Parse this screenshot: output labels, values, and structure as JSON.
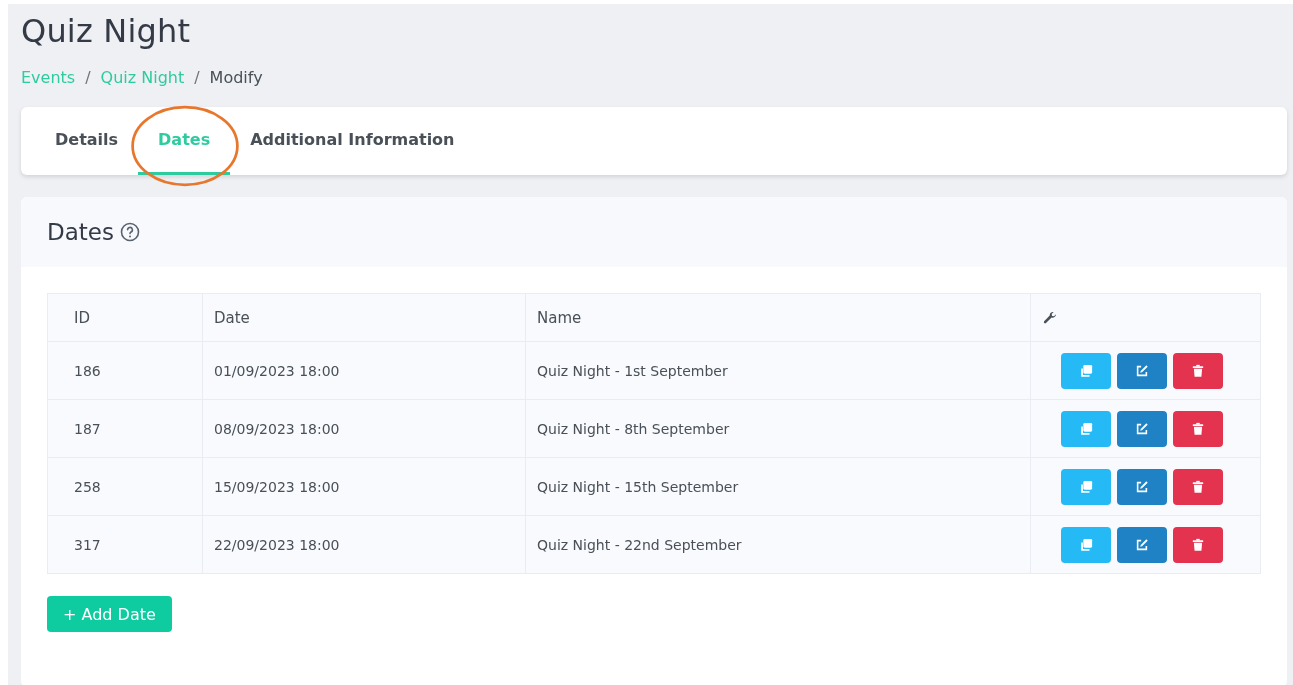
{
  "page": {
    "title": "Quiz Night"
  },
  "breadcrumb": [
    {
      "label": "Events",
      "link": true
    },
    {
      "label": "Quiz Night",
      "link": true
    },
    {
      "label": "Modify",
      "link": false
    }
  ],
  "breadcrumb_separator": "/",
  "tabs": [
    {
      "label": "Details",
      "selected": false,
      "circled": false
    },
    {
      "label": "Dates",
      "selected": true,
      "circled": true
    },
    {
      "label": "Additional Information",
      "selected": false,
      "circled": false
    }
  ],
  "section": {
    "title": "Dates"
  },
  "table": {
    "columns": [
      {
        "label": "ID",
        "kind": "text"
      },
      {
        "label": "Date",
        "kind": "text"
      },
      {
        "label": "Name",
        "kind": "text"
      },
      {
        "kind": "tools"
      }
    ],
    "rows": [
      {
        "id": "186",
        "date": "01/09/2023 18:00",
        "name": "Quiz Night - 1st September"
      },
      {
        "id": "187",
        "date": "08/09/2023 18:00",
        "name": "Quiz Night - 8th September"
      },
      {
        "id": "258",
        "date": "15/09/2023 18:00",
        "name": "Quiz Night - 15th September"
      },
      {
        "id": "317",
        "date": "22/09/2023 18:00",
        "name": "Quiz Night - 22nd September"
      }
    ],
    "actions": [
      {
        "kind": "duplicate"
      },
      {
        "kind": "edit"
      },
      {
        "kind": "delete"
      }
    ]
  },
  "add_button": "+ Add Date"
}
